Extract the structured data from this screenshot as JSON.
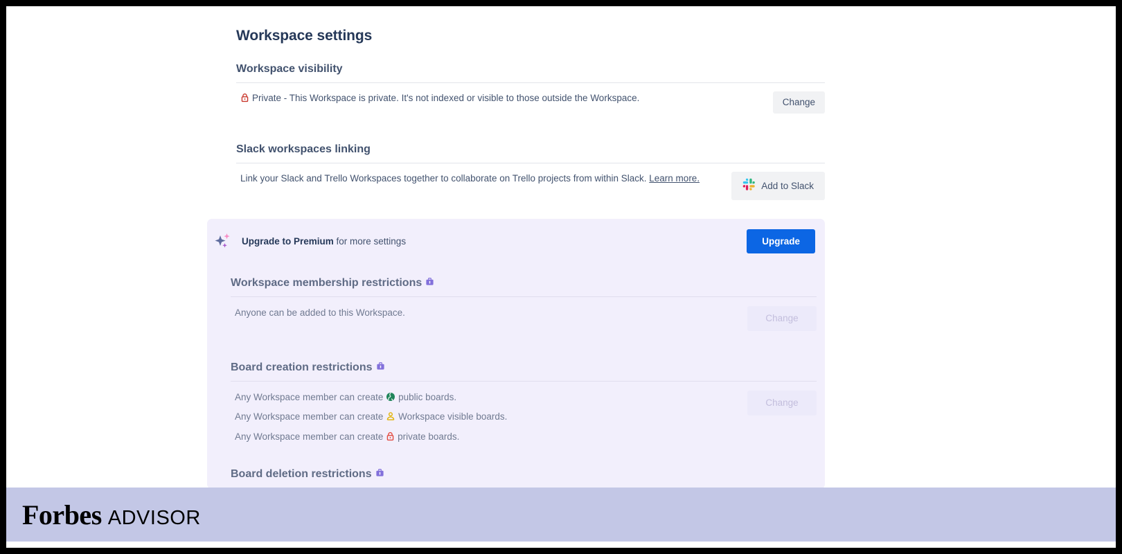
{
  "page": {
    "title": "Workspace settings"
  },
  "visibility": {
    "heading": "Workspace visibility",
    "icon": "lock-icon",
    "text": "Private - This Workspace is private. It's not indexed or visible to those outside the Workspace.",
    "change_label": "Change"
  },
  "slack": {
    "heading": "Slack workspaces linking",
    "text": "Link your Slack and Trello Workspaces together to collaborate on Trello projects from within Slack. ",
    "link_label": "Learn more.",
    "button_label": "Add to Slack",
    "button_icon": "slack-icon"
  },
  "premium_banner": {
    "icon": "sparkle-icon",
    "bold_text": "Upgrade to Premium",
    "rest_text": " for more settings",
    "upgrade_label": "Upgrade"
  },
  "membership": {
    "heading": "Workspace membership restrictions",
    "badge_icon": "premium-badge-icon",
    "text": "Anyone can be added to this Workspace.",
    "change_label": "Change"
  },
  "board_creation": {
    "heading": "Board creation restrictions",
    "badge_icon": "premium-badge-icon",
    "change_label": "Change",
    "lines": [
      {
        "prefix": "Any Workspace member can create ",
        "icon": "globe-icon",
        "suffix": "public boards."
      },
      {
        "prefix": "Any Workspace member can create ",
        "icon": "workspace-visible-icon",
        "suffix": "Workspace visible boards."
      },
      {
        "prefix": "Any Workspace member can create ",
        "icon": "lock-icon",
        "suffix": "private boards."
      }
    ]
  },
  "board_deletion": {
    "heading": "Board deletion restrictions",
    "badge_icon": "premium-badge-icon"
  },
  "footer": {
    "brand": "Forbes",
    "sub": "ADVISOR"
  },
  "colors": {
    "accent_blue": "#0c66e4",
    "premium_bg": "#f2effc",
    "footer_bg": "#c3c7e6",
    "heading": "#253858",
    "body_text": "#42526e",
    "lock_red": "#c9372c",
    "globe_green": "#1f845a",
    "workspace_yellow": "#e2b203",
    "badge_purple": "#8270db"
  }
}
